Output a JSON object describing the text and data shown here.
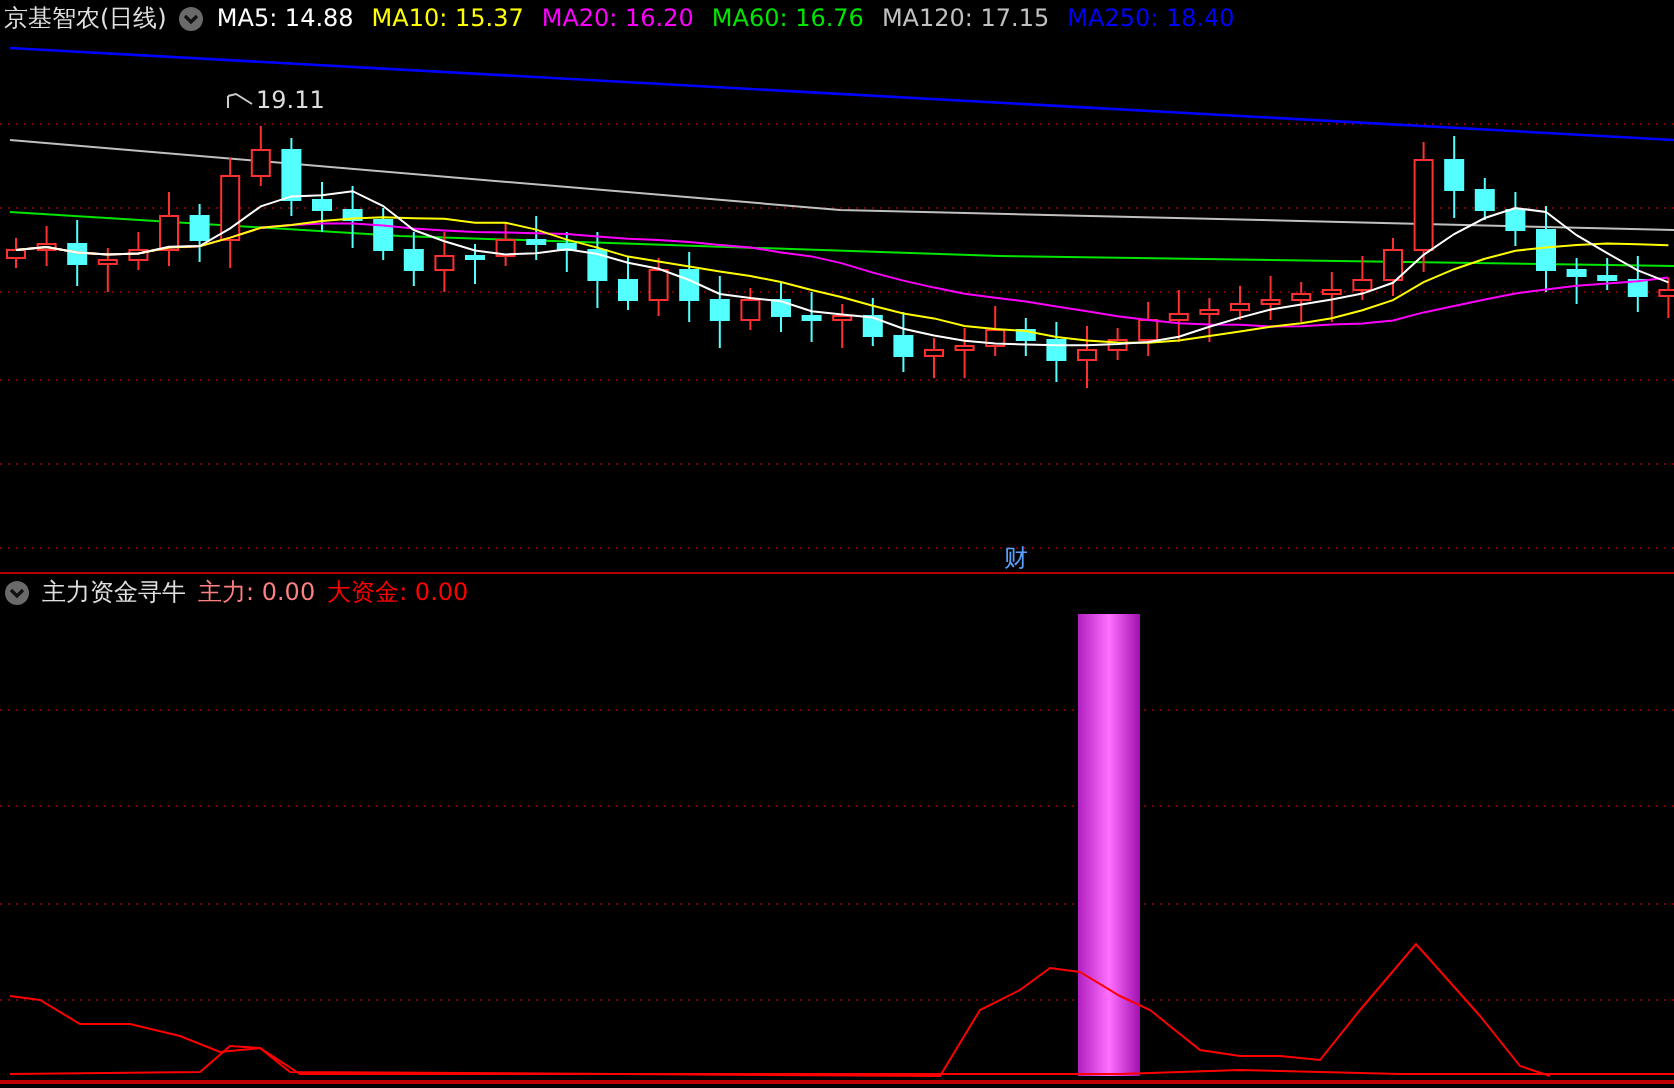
{
  "title": "京基智农(日线)",
  "moving_averages": [
    {
      "label": "MA5:",
      "value": "14.88",
      "color": "#ffffff"
    },
    {
      "label": "MA10:",
      "value": "15.37",
      "color": "#ffff00"
    },
    {
      "label": "MA20:",
      "value": "16.20",
      "color": "#ff00ff"
    },
    {
      "label": "MA60:",
      "value": "16.76",
      "color": "#00e600"
    },
    {
      "label": "MA120:",
      "value": "17.15",
      "color": "#c0c0c0"
    },
    {
      "label": "MA250:",
      "value": "18.40",
      "color": "#0000ff"
    }
  ],
  "high_marker": "19.11",
  "event_marker": "财",
  "indicator": {
    "title": "主力资金寻牛",
    "series": [
      {
        "label": "主力:",
        "value": "0.00",
        "color": "#ff8080"
      },
      {
        "label": "大资金:",
        "value": "0.00",
        "color": "#ff0000"
      }
    ]
  }
}
